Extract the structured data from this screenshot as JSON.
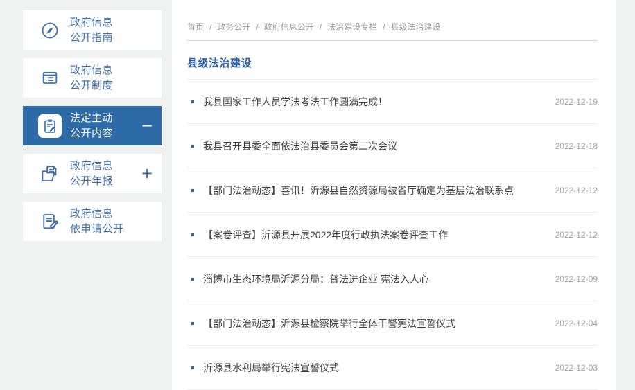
{
  "colors": {
    "accent_blue": "#2e6aa5",
    "sidebar_text_blue": "#3e6da8",
    "title_blue": "#2a5da7",
    "item_text": "#3d3d3d",
    "date_gray": "#a3a3a3",
    "breadcrumb_gray": "#9b9b9b",
    "page_background": "#f0f1f1"
  },
  "sidebar": {
    "items": [
      {
        "label_line1": "政府信息",
        "label_line2": "公开指南",
        "icon": "compass-icon",
        "active": false,
        "expander": ""
      },
      {
        "label_line1": "政府信息",
        "label_line2": "公开制度",
        "icon": "document-list-icon",
        "active": false,
        "expander": ""
      },
      {
        "label_line1": "法定主动",
        "label_line2": "公开内容",
        "icon": "clipboard-pencil-icon",
        "active": true,
        "expander": "−"
      },
      {
        "label_line1": "政府信息",
        "label_line2": "公开年报",
        "icon": "folder-document-icon",
        "active": false,
        "expander": "+"
      },
      {
        "label_line1": "政府信息",
        "label_line2": "依申请公开",
        "icon": "document-pen-icon",
        "active": false,
        "expander": ""
      }
    ]
  },
  "breadcrumb": {
    "separator": "/",
    "items": [
      "首页",
      "政务公开",
      "政府信息公开",
      "法治建设专栏",
      "县级法治建设"
    ]
  },
  "main": {
    "title": "县级法治建设",
    "articles": [
      {
        "title": "我县国家工作人员学法考法工作圆满完成！",
        "date": "2022-12-19"
      },
      {
        "title": "我县召开县委全面依法治县委员会第二次会议",
        "date": "2022-12-18"
      },
      {
        "title": "【部门法治动态】喜讯！沂源县自然资源局被省厅确定为基层法治联系点",
        "date": "2022-12-12"
      },
      {
        "title": "【案卷评查】沂源县开展2022年度行政执法案卷评查工作",
        "date": "2022-12-12"
      },
      {
        "title": "淄博市生态环境局沂源分局：普法进企业 宪法入人心",
        "date": "2022-12-09"
      },
      {
        "title": "【部门法治动态】沂源县检察院举行全体干警宪法宣誓仪式",
        "date": "2022-12-04"
      },
      {
        "title": "沂源县水利局举行宪法宣誓仪式",
        "date": "2022-12-03"
      }
    ]
  }
}
